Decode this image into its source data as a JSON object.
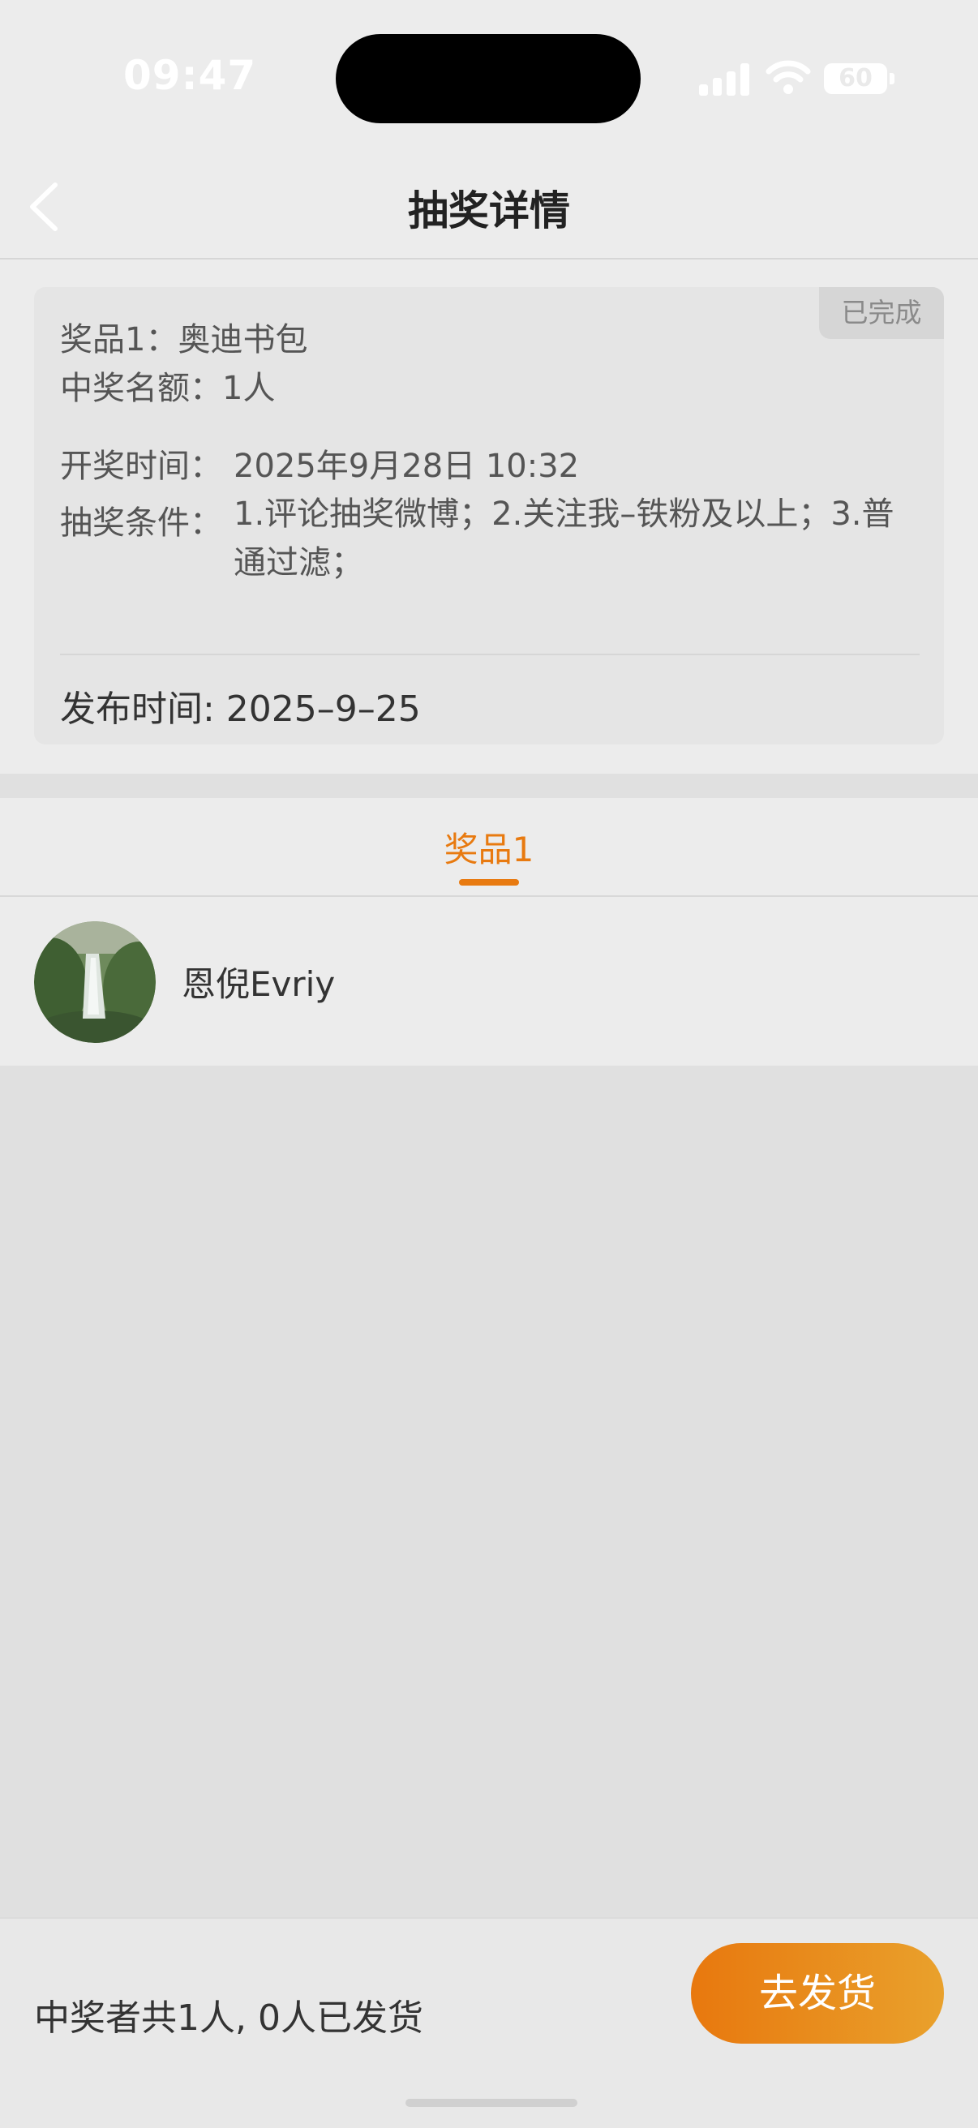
{
  "status_bar": {
    "time": "09:47",
    "battery": "60"
  },
  "nav": {
    "title": "抽奖详情",
    "back_icon": "chevron-left-icon"
  },
  "card": {
    "status": "已完成",
    "prize_line": "奖品1：奥迪书包",
    "quota_line": "中奖名额：1人",
    "draw_time_label": "开奖时间：",
    "draw_time_value": "2025年9月28日 10:32",
    "condition_label": "抽奖条件：",
    "condition_value": "1.评论抽奖微博；2.关注我–铁粉及以上；3.普通过滤；",
    "publish_line": "发布时间: 2025–9–25"
  },
  "tabs": [
    {
      "label": "奖品1",
      "active": true
    }
  ],
  "winners": [
    {
      "name": "恩倪Evriy"
    }
  ],
  "footer": {
    "summary": "中奖者共1人, 0人已发货",
    "ship_button": "去发货"
  },
  "colors": {
    "accent": "#e87a10",
    "accent_end": "#e9a12c"
  }
}
